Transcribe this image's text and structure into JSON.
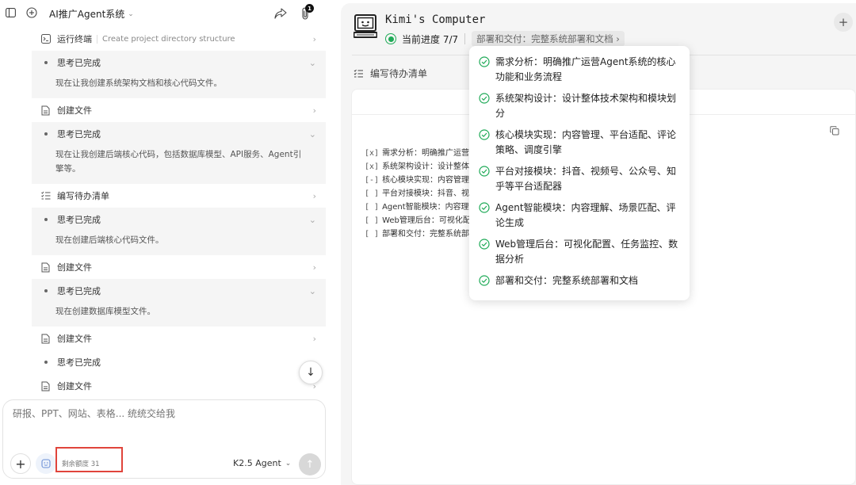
{
  "left": {
    "chat_title": "AI推广Agent系统",
    "notification_count": "1",
    "steps": [
      {
        "kind": "terminal",
        "label": "运行终端",
        "sub": "Create project directory structure"
      },
      {
        "kind": "thought",
        "label": "思考已完成",
        "text": "现在让我创建系统架构文档和核心代码文件。"
      },
      {
        "kind": "file",
        "label": "创建文件"
      },
      {
        "kind": "thought",
        "label": "思考已完成",
        "text": "现在让我创建后端核心代码，包括数据库模型、API服务、Agent引擎等。"
      },
      {
        "kind": "todo",
        "label": "编写待办清单"
      },
      {
        "kind": "thought",
        "label": "思考已完成",
        "text": "现在创建后端核心代码文件。"
      },
      {
        "kind": "file",
        "label": "创建文件"
      },
      {
        "kind": "thought",
        "label": "思考已完成",
        "text": "现在创建数据库模型文件。"
      },
      {
        "kind": "file",
        "label": "创建文件"
      },
      {
        "kind": "thought-collapsed",
        "label": "思考已完成"
      },
      {
        "kind": "file",
        "label": "创建文件"
      }
    ],
    "composer": {
      "placeholder": "研报、PPT、网站、表格... 统统交给我",
      "quota_label": "剩余额度 31",
      "model": "K2.5 Agent"
    }
  },
  "right": {
    "title": "Kimi's Computer",
    "progress_label": "当前进度 7/7",
    "progress_current": 7,
    "progress_total": 7,
    "current_task_chip": "部署和交付：完整系统部署和文档",
    "section_title": "编写待办清单",
    "todo_lines": [
      {
        "box": "[x]",
        "text": "需求分析：明确推广运营"
      },
      {
        "box": "[x]",
        "text": "系统架构设计：设计整体"
      },
      {
        "box": "[-]",
        "text": "核心模块实现：内容管理"
      },
      {
        "box": "[ ]",
        "text": "平台对接模块：抖音、视"
      },
      {
        "box": "[ ]",
        "text": "Agent智能模块：内容理"
      },
      {
        "box": "[ ]",
        "text": "Web管理后台：可视化配"
      },
      {
        "box": "[ ]",
        "text": "部署和交付：完整系统部"
      }
    ],
    "popover_items": [
      {
        "text": "需求分析：明确推广运营Agent系统的核心功能和业务流程",
        "done": true
      },
      {
        "text": "系统架构设计：设计整体技术架构和模块划分",
        "done": true
      },
      {
        "text": "核心模块实现：内容管理、平台适配、评论策略、调度引擎",
        "done": true
      },
      {
        "text": "平台对接模块：抖音、视频号、公众号、知乎等平台适配器",
        "done": true
      },
      {
        "text": "Agent智能模块：内容理解、场景匹配、评论生成",
        "done": true
      },
      {
        "text": "Web管理后台：可视化配置、任务监控、数据分析",
        "done": true
      },
      {
        "text": "部署和交付：完整系统部署和文档",
        "done": true
      }
    ],
    "accent_green": "#1faa57"
  }
}
